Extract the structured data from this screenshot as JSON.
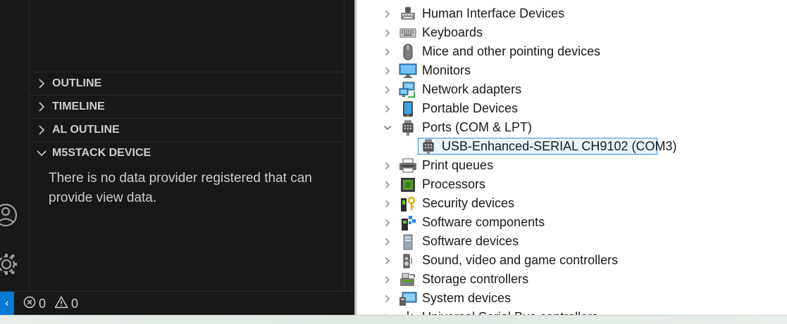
{
  "vscode": {
    "sections": [
      {
        "label": "OUTLINE",
        "expanded": false
      },
      {
        "label": "TIMELINE",
        "expanded": false
      },
      {
        "label": "AL OUTLINE",
        "expanded": false
      },
      {
        "label": "M5STACK DEVICE",
        "expanded": true
      }
    ],
    "empty_message": "There is no data provider registered that can provide view data.",
    "status": {
      "errors": "0",
      "warnings": "0",
      "accent_color": "#0078d4"
    }
  },
  "device_manager": {
    "categories": [
      {
        "label": "Human Interface Devices",
        "icon": "hid-icon"
      },
      {
        "label": "Keyboards",
        "icon": "keyboard-icon"
      },
      {
        "label": "Mice and other pointing devices",
        "icon": "mouse-icon"
      },
      {
        "label": "Monitors",
        "icon": "monitor-icon"
      },
      {
        "label": "Network adapters",
        "icon": "network-icon"
      },
      {
        "label": "Portable Devices",
        "icon": "portable-device-icon"
      },
      {
        "label": "Ports (COM & LPT)",
        "icon": "port-icon",
        "expanded": true
      },
      {
        "label": "USB-Enhanced-SERIAL CH9102 (COM3)",
        "icon": "port-icon",
        "child": true,
        "selected": true
      },
      {
        "label": "Print queues",
        "icon": "printer-icon"
      },
      {
        "label": "Processors",
        "icon": "processor-icon"
      },
      {
        "label": "Security devices",
        "icon": "security-icon"
      },
      {
        "label": "Software components",
        "icon": "software-component-icon"
      },
      {
        "label": "Software devices",
        "icon": "software-device-icon"
      },
      {
        "label": "Sound, video and game controllers",
        "icon": "speaker-icon"
      },
      {
        "label": "Storage controllers",
        "icon": "storage-icon"
      },
      {
        "label": "System devices",
        "icon": "system-device-icon"
      },
      {
        "label": "Universal Serial Bus controllers",
        "icon": "usb-icon"
      }
    ]
  }
}
